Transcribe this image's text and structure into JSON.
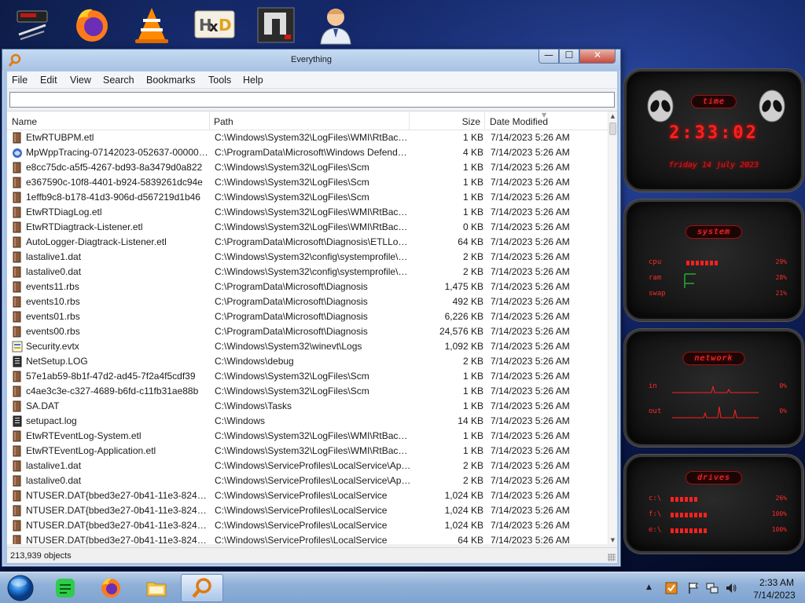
{
  "desktop": {
    "icons": [
      "tool-icon",
      "firefox-icon",
      "vlc-icon",
      "hxd-icon",
      "app-icon",
      "doctor-icon"
    ]
  },
  "gadgets": {
    "time": {
      "title": "time",
      "clock": "2:33:02",
      "date": "friday 14 july 2023"
    },
    "system": {
      "title": "system",
      "cpu_label": "cpu",
      "cpu_value": "29%",
      "cpu_level": 0.29,
      "ram_label": "ram",
      "ram_value": "28%",
      "swap_label": "swap",
      "swap_value": "21%"
    },
    "network": {
      "title": "network",
      "in_label": "in",
      "in_value": "0%",
      "out_label": "out",
      "out_value": "0%"
    },
    "drives": {
      "title": "drives",
      "items": [
        {
          "label": "c:\\",
          "value": "26%",
          "level": 0.26
        },
        {
          "label": "f:\\",
          "value": "100%",
          "level": 1.0
        },
        {
          "label": "e:\\",
          "value": "100%",
          "level": 1.0
        }
      ]
    }
  },
  "window": {
    "title": "Everything",
    "controls": {
      "minimize": "—",
      "maximize": "☐",
      "close": "✕"
    },
    "menu": [
      "File",
      "Edit",
      "View",
      "Search",
      "Bookmarks",
      "Tools",
      "Help"
    ],
    "search": {
      "value": "",
      "placeholder": ""
    },
    "columns": {
      "name": "Name",
      "path": "Path",
      "size": "Size",
      "date": "Date Modified"
    },
    "rows": [
      {
        "icon": "etl",
        "name": "EtwRTUBPM.etl",
        "path": "C:\\Windows\\System32\\LogFiles\\WMI\\RtBackup",
        "size": "1 KB",
        "date": "7/14/2023 5:26 AM"
      },
      {
        "icon": "defender",
        "name": "MpWppTracing-07142023-052637-00000003...",
        "path": "C:\\ProgramData\\Microsoft\\Windows Defender\\...",
        "size": "4 KB",
        "date": "7/14/2023 5:26 AM"
      },
      {
        "icon": "file",
        "name": "e8cc75dc-a5f5-4267-bd93-8a3479d0a822",
        "path": "C:\\Windows\\System32\\LogFiles\\Scm",
        "size": "1 KB",
        "date": "7/14/2023 5:26 AM"
      },
      {
        "icon": "file",
        "name": "e367590c-10f8-4401-b924-5839261dc94e",
        "path": "C:\\Windows\\System32\\LogFiles\\Scm",
        "size": "1 KB",
        "date": "7/14/2023 5:26 AM"
      },
      {
        "icon": "file",
        "name": "1effb9c8-b178-41d3-906d-d567219d1b46",
        "path": "C:\\Windows\\System32\\LogFiles\\Scm",
        "size": "1 KB",
        "date": "7/14/2023 5:26 AM"
      },
      {
        "icon": "file",
        "name": "EtwRTDiagLog.etl",
        "path": "C:\\Windows\\System32\\LogFiles\\WMI\\RtBackup",
        "size": "1 KB",
        "date": "7/14/2023 5:26 AM"
      },
      {
        "icon": "file",
        "name": "EtwRTDiagtrack-Listener.etl",
        "path": "C:\\Windows\\System32\\LogFiles\\WMI\\RtBackup",
        "size": "0 KB",
        "date": "7/14/2023 5:26 AM"
      },
      {
        "icon": "file",
        "name": "AutoLogger-Diagtrack-Listener.etl",
        "path": "C:\\ProgramData\\Microsoft\\Diagnosis\\ETLLogs\\...",
        "size": "64 KB",
        "date": "7/14/2023 5:26 AM"
      },
      {
        "icon": "file",
        "name": "lastalive1.dat",
        "path": "C:\\Windows\\System32\\config\\systemprofile\\Ap...",
        "size": "2 KB",
        "date": "7/14/2023 5:26 AM"
      },
      {
        "icon": "file",
        "name": "lastalive0.dat",
        "path": "C:\\Windows\\System32\\config\\systemprofile\\Ap...",
        "size": "2 KB",
        "date": "7/14/2023 5:26 AM"
      },
      {
        "icon": "file",
        "name": "events11.rbs",
        "path": "C:\\ProgramData\\Microsoft\\Diagnosis",
        "size": "1,475 KB",
        "date": "7/14/2023 5:26 AM"
      },
      {
        "icon": "file",
        "name": "events10.rbs",
        "path": "C:\\ProgramData\\Microsoft\\Diagnosis",
        "size": "492 KB",
        "date": "7/14/2023 5:26 AM"
      },
      {
        "icon": "file",
        "name": "events01.rbs",
        "path": "C:\\ProgramData\\Microsoft\\Diagnosis",
        "size": "6,226 KB",
        "date": "7/14/2023 5:26 AM"
      },
      {
        "icon": "file",
        "name": "events00.rbs",
        "path": "C:\\ProgramData\\Microsoft\\Diagnosis",
        "size": "24,576 KB",
        "date": "7/14/2023 5:26 AM"
      },
      {
        "icon": "evtx",
        "name": "Security.evtx",
        "path": "C:\\Windows\\System32\\winevt\\Logs",
        "size": "1,092 KB",
        "date": "7/14/2023 5:26 AM"
      },
      {
        "icon": "log",
        "name": "NetSetup.LOG",
        "path": "C:\\Windows\\debug",
        "size": "2 KB",
        "date": "7/14/2023 5:26 AM"
      },
      {
        "icon": "file",
        "name": "57e1ab59-8b1f-47d2-ad45-7f2a4f5cdf39",
        "path": "C:\\Windows\\System32\\LogFiles\\Scm",
        "size": "1 KB",
        "date": "7/14/2023 5:26 AM"
      },
      {
        "icon": "file",
        "name": "c4ae3c3e-c327-4689-b6fd-c11fb31ae88b",
        "path": "C:\\Windows\\System32\\LogFiles\\Scm",
        "size": "1 KB",
        "date": "7/14/2023 5:26 AM"
      },
      {
        "icon": "file",
        "name": "SA.DAT",
        "path": "C:\\Windows\\Tasks",
        "size": "1 KB",
        "date": "7/14/2023 5:26 AM"
      },
      {
        "icon": "log",
        "name": "setupact.log",
        "path": "C:\\Windows",
        "size": "14 KB",
        "date": "7/14/2023 5:26 AM"
      },
      {
        "icon": "file",
        "name": "EtwRTEventLog-System.etl",
        "path": "C:\\Windows\\System32\\LogFiles\\WMI\\RtBackup",
        "size": "1 KB",
        "date": "7/14/2023 5:26 AM"
      },
      {
        "icon": "file",
        "name": "EtwRTEventLog-Application.etl",
        "path": "C:\\Windows\\System32\\LogFiles\\WMI\\RtBackup",
        "size": "1 KB",
        "date": "7/14/2023 5:26 AM"
      },
      {
        "icon": "file",
        "name": "lastalive1.dat",
        "path": "C:\\Windows\\ServiceProfiles\\LocalService\\AppDa...",
        "size": "2 KB",
        "date": "7/14/2023 5:26 AM"
      },
      {
        "icon": "file",
        "name": "lastalive0.dat",
        "path": "C:\\Windows\\ServiceProfiles\\LocalService\\AppDa...",
        "size": "2 KB",
        "date": "7/14/2023 5:26 AM"
      },
      {
        "icon": "file",
        "name": "NTUSER.DAT{bbed3e27-0b41-11e3-8249-d6...",
        "path": "C:\\Windows\\ServiceProfiles\\LocalService",
        "size": "1,024 KB",
        "date": "7/14/2023 5:26 AM"
      },
      {
        "icon": "file",
        "name": "NTUSER.DAT{bbed3e27-0b41-11e3-8249-d6...",
        "path": "C:\\Windows\\ServiceProfiles\\LocalService",
        "size": "1,024 KB",
        "date": "7/14/2023 5:26 AM"
      },
      {
        "icon": "file",
        "name": "NTUSER.DAT{bbed3e27-0b41-11e3-8249-d6...",
        "path": "C:\\Windows\\ServiceProfiles\\LocalService",
        "size": "1,024 KB",
        "date": "7/14/2023 5:26 AM"
      },
      {
        "icon": "file",
        "name": "NTUSER.DAT{bbed3e27-0b41-11e3-8249-d6...",
        "path": "C:\\Windows\\ServiceProfiles\\LocalService",
        "size": "64 KB",
        "date": "7/14/2023 5:26 AM"
      }
    ],
    "status": "213,939 objects"
  },
  "taskbar": {
    "buttons": [
      "start-orb-icon",
      "notes-icon",
      "firefox-icon",
      "explorer-icon",
      "everything-icon"
    ],
    "active": "everything-icon",
    "tray_icons": [
      "show-hidden-icon",
      "security-icon",
      "flag-icon",
      "network-icon",
      "volume-icon"
    ],
    "time": "2:33 AM",
    "date": "7/14/2023"
  },
  "colors": {
    "accent_red": "#ff2020",
    "window_frame": "#a9c3e4",
    "taskbar": "#8fb0d8"
  }
}
